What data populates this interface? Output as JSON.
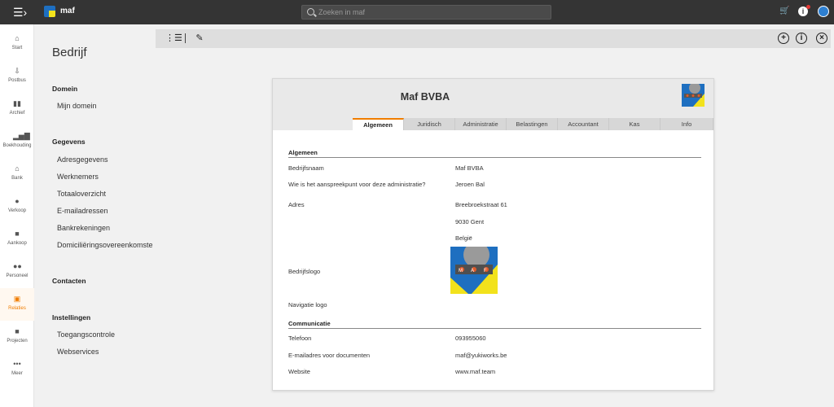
{
  "topbar": {
    "app_name": "maf",
    "search_placeholder": "Zoeken in maf",
    "icons": [
      "menu-icon",
      "cart-icon",
      "info-icon",
      "user-icon"
    ]
  },
  "leftnav": {
    "items": [
      {
        "label": "Start",
        "icon": "home-icon"
      },
      {
        "label": "Postbus",
        "icon": "inbox-icon"
      },
      {
        "label": "Archief",
        "icon": "archive-icon"
      },
      {
        "label": "Boekhouding",
        "icon": "bar-chart-icon"
      },
      {
        "label": "Bank",
        "icon": "bank-icon"
      },
      {
        "label": "Verkoop",
        "icon": "sales-icon"
      },
      {
        "label": "Aankoop",
        "icon": "truck-icon"
      },
      {
        "label": "Personeel",
        "icon": "people-icon"
      },
      {
        "label": "Relaties",
        "icon": "contacts-icon",
        "active": true
      },
      {
        "label": "Projecten",
        "icon": "folder-icon"
      },
      {
        "label": "Meer",
        "icon": "more-icon"
      }
    ],
    "active_color": "#f07d00"
  },
  "sidebar": {
    "title": "Bedrijf",
    "sections": [
      {
        "title": "Domein",
        "links": [
          "Mijn domein"
        ]
      },
      {
        "title": "Gegevens",
        "links": [
          "Adresgegevens",
          "Werknemers",
          "Totaaloverzicht",
          "E-mailadressen",
          "Bankrekeningen",
          "Domiciliëringsovereenkomsten"
        ]
      },
      {
        "title": "Contacten",
        "links": []
      },
      {
        "title": "Instellingen",
        "links": [
          "Toegangscontrole",
          "Webservices"
        ]
      }
    ]
  },
  "toolbar": {
    "icons": [
      "collapse-list-icon",
      "edit-pencil-icon",
      "add-circle-icon",
      "info-circle-icon",
      "close-circle-icon"
    ]
  },
  "card": {
    "company_name": "Maf BVBA",
    "tabs": [
      "Algemeen",
      "Juridisch",
      "Administratie",
      "Belastingen",
      "Accountant",
      "Kas",
      "Info"
    ],
    "active_tab": "Algemeen",
    "general": {
      "title": "Algemeen",
      "company_name_label": "Bedrijfsnaam",
      "company_name_value": "Maf BVBA",
      "contact_label": "Wie is het aanspreekpunt voor deze administratie?",
      "contact_value": "Jeroen Bal",
      "address_label": "Adres",
      "address_street": "Breebroekstraat 61",
      "address_city": "9030 Gent",
      "address_country": "België",
      "logo_label": "Bedrijfslogo",
      "logo_letters": [
        "M",
        "A",
        "F"
      ],
      "nav_logo_label": "Navigatie logo"
    },
    "communication": {
      "title": "Communicatie",
      "phone_label": "Telefoon",
      "phone_value": "093955060",
      "email_label": "E-mailadres voor documenten",
      "email_value": "maf@yukiworks.be",
      "website_label": "Website",
      "website_value": "www.maf.team"
    }
  }
}
